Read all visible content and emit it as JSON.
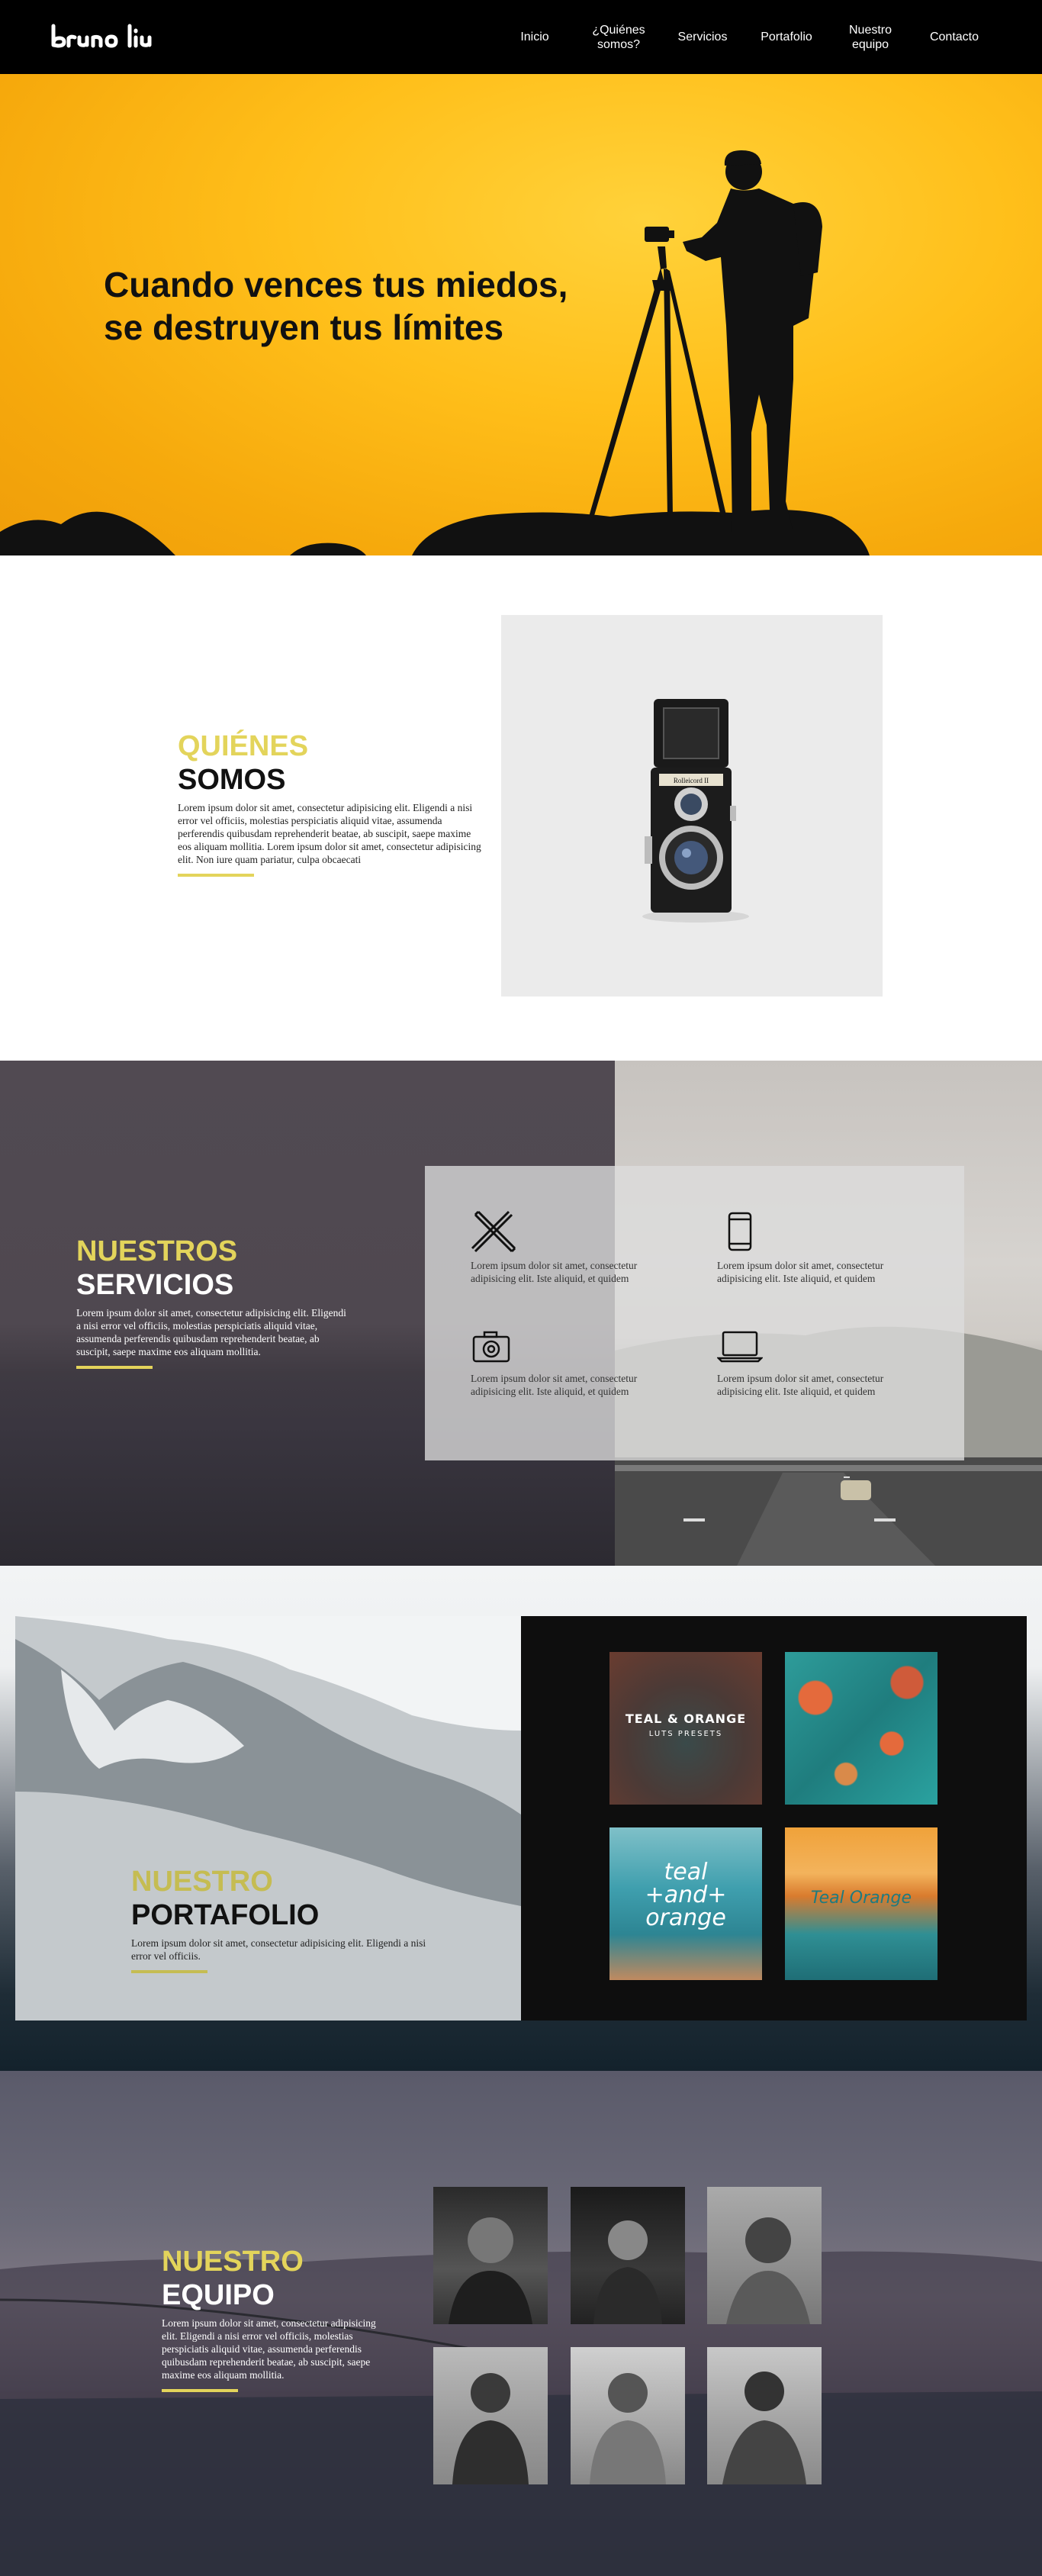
{
  "nav": {
    "logo_alt": "bruno liu",
    "items": [
      {
        "label": "Inicio"
      },
      {
        "label": "¿Quiénes\nsomos?"
      },
      {
        "label": "Servicios"
      },
      {
        "label": "Portafolio"
      },
      {
        "label": "Nuestro\nequipo"
      },
      {
        "label": "Contacto"
      }
    ]
  },
  "hero": {
    "headline": "Cuando vences tus miedos,\nse destruyen tus límites",
    "bg_color": "#ffbf1a"
  },
  "about": {
    "title_accent": "QUIÉNES",
    "title_main": "SOMOS",
    "body": "Lorem ipsum dolor sit amet, consectetur adipisicing elit. Eligendi a nisi error vel officiis, molestias perspiciatis aliquid vitae, assumenda perferendis quibusdam reprehenderit beatae, ab suscipit, saepe maxime eos aliquam mollitia. Lorem ipsum dolor sit amet, consectetur adipisicing elit. Non iure quam pariatur, culpa obcaecati",
    "camera_brand": "Rolleicord II"
  },
  "services": {
    "title_accent": "NUESTROS",
    "title_main": "SERVICIOS",
    "body": "Lorem ipsum dolor sit amet, consectetur adipisicing elit. Eligendi a nisi error vel officiis, molestias perspiciatis aliquid vitae, assumenda perferendis quibusdam reprehenderit beatae, ab suscipit, saepe maxime eos aliquam mollitia.",
    "items": [
      {
        "icon": "design-tools-icon",
        "text": "Lorem ipsum dolor sit amet, consectetur adipisicing elit. Iste aliquid, et quidem"
      },
      {
        "icon": "smartphone-icon",
        "text": "Lorem ipsum dolor sit amet, consectetur adipisicing elit. Iste aliquid, et quidem"
      },
      {
        "icon": "camera-icon",
        "text": "Lorem ipsum dolor sit amet, consectetur adipisicing elit. Iste aliquid, et quidem"
      },
      {
        "icon": "laptop-icon",
        "text": "Lorem ipsum dolor sit amet, consectetur adipisicing elit. Iste aliquid, et quidem"
      }
    ]
  },
  "portfolio": {
    "title_accent": "NUESTRO",
    "title_main": "PORTAFOLIO",
    "body": "Lorem ipsum dolor sit amet, consectetur adipisicing elit. Eligendi a nisi error vel officiis.",
    "tiles": [
      {
        "label": "TEAL & ORANGE",
        "sublabel": "LUTS PRESETS"
      },
      {
        "label": ""
      },
      {
        "label": "teal\n+and+\norange",
        "sublabel": ""
      },
      {
        "label": "Teal Orange",
        "sublabel": ""
      }
    ]
  },
  "team": {
    "title_accent": "NUESTRO",
    "title_main": "EQUIPO",
    "body": "Lorem ipsum dolor sit amet, consectetur adipisicing elit. Eligendi a nisi error vel officiis, molestias perspiciatis aliquid vitae, assumenda perferendis quibusdam reprehenderit beatae, ab suscipit, saepe maxime eos aliquam mollitia."
  }
}
